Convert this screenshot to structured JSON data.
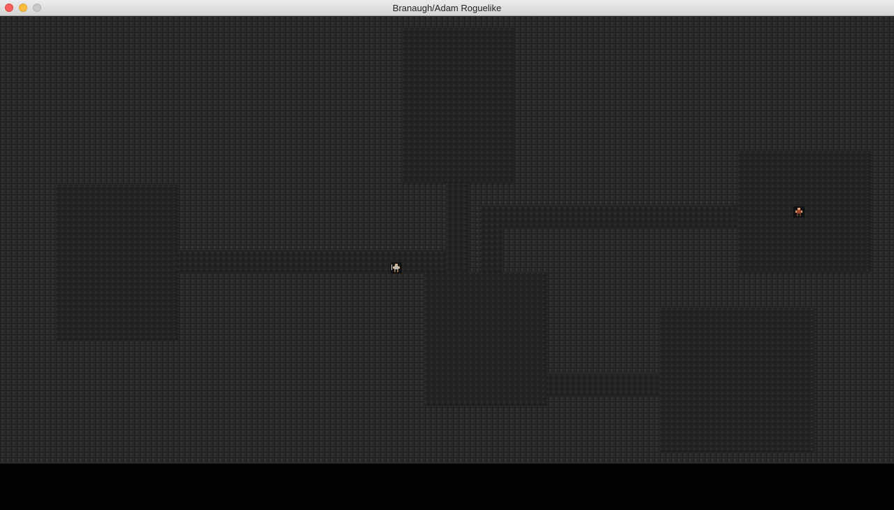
{
  "window": {
    "title": "Branaugh/Adam Roguelike",
    "controls": [
      "close-icon",
      "minimize-icon",
      "zoom-icon"
    ]
  },
  "game": {
    "wall_color": "#2a2a2a",
    "floor_color": "#232323",
    "entities": [
      {
        "kind": "player",
        "icon": "player-sprite-icon"
      },
      {
        "kind": "monster",
        "icon": "monster-sprite-icon"
      }
    ]
  }
}
